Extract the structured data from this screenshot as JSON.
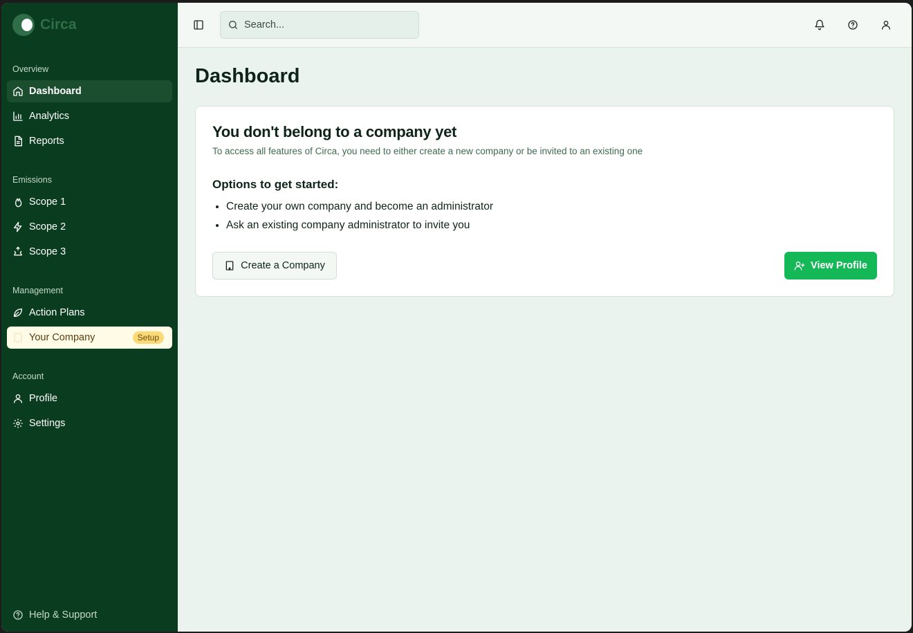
{
  "brand": {
    "name": "Circa"
  },
  "sidebar": {
    "sections": [
      {
        "label": "Overview",
        "items": [
          {
            "label": "Dashboard",
            "icon": "home-icon"
          },
          {
            "label": "Analytics",
            "icon": "bar-chart-icon"
          },
          {
            "label": "Reports",
            "icon": "file-text-icon"
          }
        ]
      },
      {
        "label": "Emissions",
        "items": [
          {
            "label": "Scope 1",
            "icon": "flame-icon"
          },
          {
            "label": "Scope 2",
            "icon": "zap-icon"
          },
          {
            "label": "Scope 3",
            "icon": "recycle-icon"
          }
        ]
      },
      {
        "label": "Management",
        "items": [
          {
            "label": "Action Plans",
            "icon": "leaf-icon"
          },
          {
            "label": "Your Company",
            "icon": "building-icon",
            "badge": "Setup"
          }
        ]
      },
      {
        "label": "Account",
        "items": [
          {
            "label": "Profile",
            "icon": "user-icon"
          },
          {
            "label": "Settings",
            "icon": "gear-icon"
          }
        ]
      }
    ],
    "help": "Help & Support"
  },
  "topbar": {
    "search_placeholder": "Search..."
  },
  "main": {
    "title": "Dashboard",
    "card": {
      "title": "You don't belong to a company yet",
      "description": "To access all features of Circa, you need to either create a new company or be invited to an existing one",
      "options_heading": "Options to get started:",
      "options": [
        "Create your own company and become an administrator",
        "Ask an existing company administrator to invite you"
      ],
      "create_button": "Create a Company",
      "profile_button": "View Profile"
    }
  },
  "colors": {
    "sidebar": "#0a3d1f",
    "accent": "#14b856",
    "badge": "#fcd977"
  }
}
